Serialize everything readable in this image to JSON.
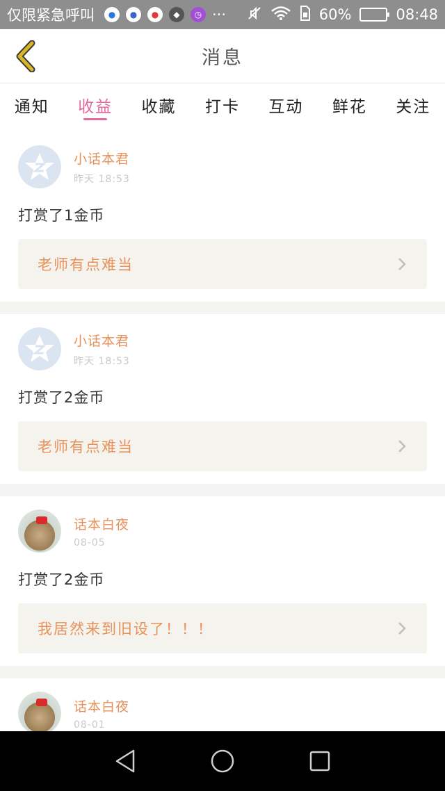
{
  "status_bar": {
    "carrier": "仅限紧急呼叫",
    "app_icons": [
      "bird-icon",
      "globe-icon",
      "mail-icon",
      "game-icon",
      "clock-app-icon"
    ],
    "more": "···",
    "battery": "60%",
    "battery_level": 0.6,
    "time": "08:48"
  },
  "header": {
    "title": "消息"
  },
  "tabs": [
    {
      "label": "通知",
      "active": false
    },
    {
      "label": "收益",
      "active": true
    },
    {
      "label": "收藏",
      "active": false
    },
    {
      "label": "打卡",
      "active": false
    },
    {
      "label": "互动",
      "active": false
    },
    {
      "label": "鲜花",
      "active": false
    },
    {
      "label": "关注",
      "active": false
    }
  ],
  "items": [
    {
      "author": "小话本君",
      "time": "昨天 18:53",
      "avatar": "qq-avatar",
      "text": "打赏了1金币",
      "post": "老师有点难当"
    },
    {
      "author": "小话本君",
      "time": "昨天 18:53",
      "avatar": "qq-avatar",
      "text": "打赏了2金币",
      "post": "老师有点难当"
    },
    {
      "author": "话本白夜",
      "time": "08-05",
      "avatar": "photo-avatar",
      "text": "打赏了2金币",
      "post": "我居然来到旧设了！！！"
    },
    {
      "author": "话本白夜",
      "time": "08-01",
      "avatar": "photo-avatar",
      "text": "",
      "post": ""
    }
  ],
  "colors": {
    "accent": "#e4699b",
    "author": "#e8915a",
    "back_arrow": "#d9b626",
    "link_bg": "#f5f3ed"
  }
}
